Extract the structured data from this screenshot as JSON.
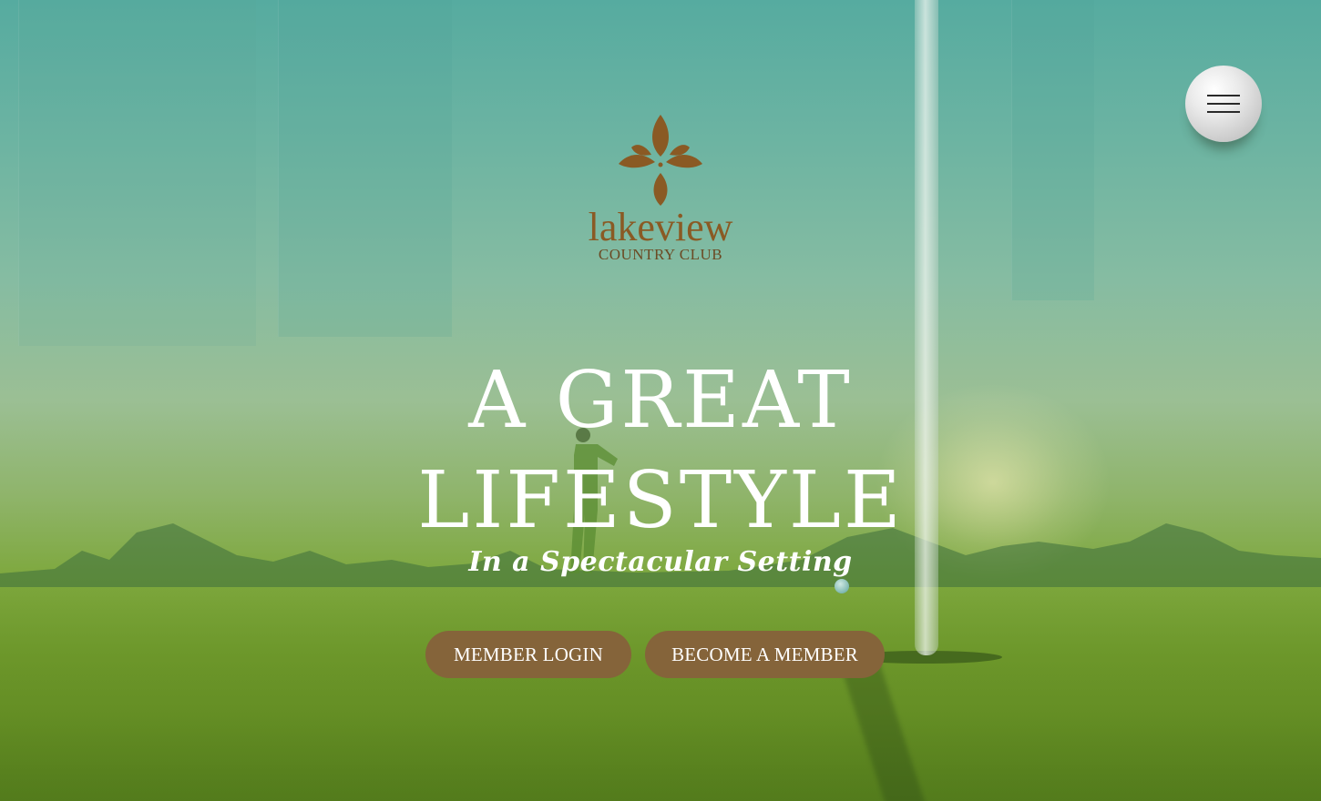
{
  "brand": {
    "name": "lakeview",
    "subtitle": "COUNTRY CLUB",
    "logo_icon": "flower-icon",
    "colors": {
      "logo": "#8a5a24",
      "button": "#85643a",
      "button_text": "#ffffff",
      "headline": "#ffffff"
    }
  },
  "nav": {
    "menu_icon": "hamburger-menu-icon"
  },
  "hero": {
    "headline": "A GREAT LIFESTYLE",
    "tagline": "In a Spectacular Setting"
  },
  "actions": {
    "login_label": "MEMBER LOGIN",
    "join_label": "BECOME A MEMBER"
  }
}
